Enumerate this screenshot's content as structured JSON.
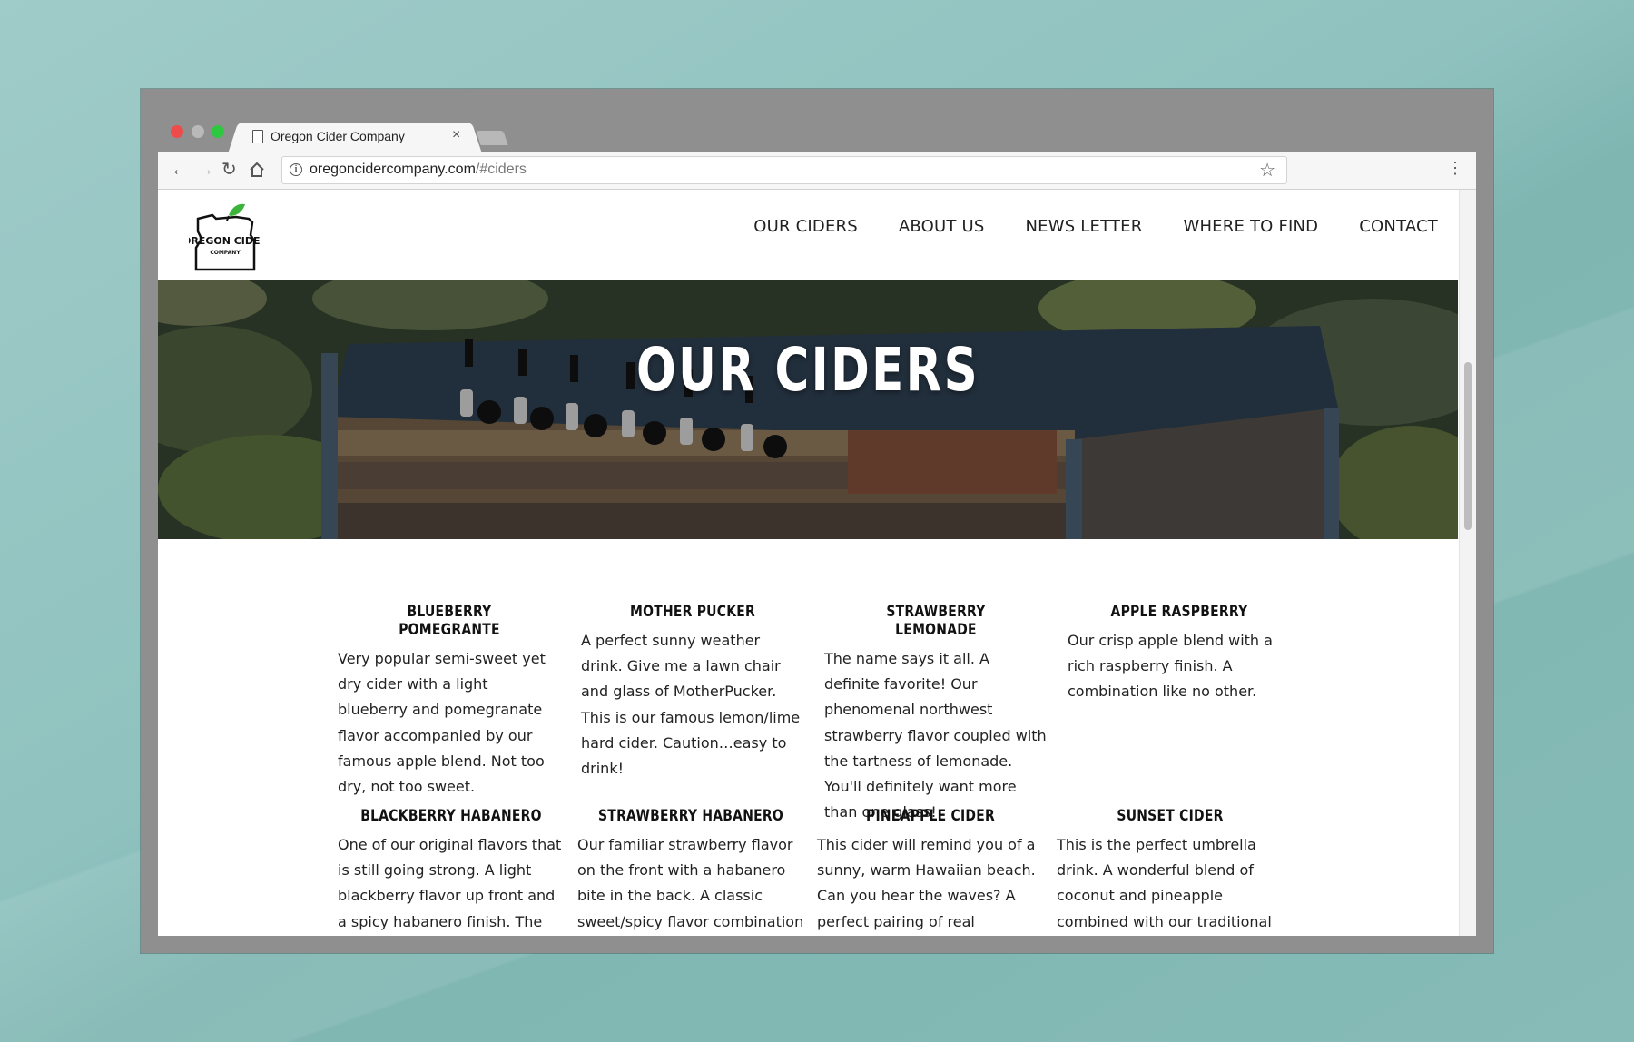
{
  "browser": {
    "tab_title": "Oregon Cider Company",
    "tab_close": "×",
    "url_host": "oregoncidercompany.com",
    "url_path": "/#ciders"
  },
  "site": {
    "logo_line1": "OREGON CIDER",
    "logo_line2": "COMPANY",
    "nav": [
      "OUR CIDERS",
      "ABOUT US",
      "NEWS LETTER",
      "WHERE TO FIND",
      "CONTACT"
    ],
    "hero_title": "OUR CIDERS"
  },
  "ciders": [
    {
      "name": "BLUEBERRY POMEGRANTE",
      "description": "Very popular semi-sweet yet dry cider with a light blueberry and pomegranate flavor accompanied by our famous apple blend. Not too dry, not too sweet."
    },
    {
      "name": "MOTHER PUCKER",
      "description": "A perfect sunny weather drink. Give me a lawn chair and glass of MotherPucker. This is our famous lemon/lime hard cider. Caution…easy to drink!"
    },
    {
      "name": "STRAWBERRY LEMONADE",
      "description": "The name says it all. A definite favorite! Our phenomenal northwest strawberry flavor coupled with the tartness of lemonade. You'll definitely want more than one glass!"
    },
    {
      "name": "APPLE RASPBERRY",
      "description": "Our crisp apple blend with a rich raspberry finish. A combination like no other."
    },
    {
      "name": "BLACKBERRY HABANERO",
      "description": "One of our original flavors that is still going strong. A light blackberry flavor up front and a spicy habanero finish. The"
    },
    {
      "name": "STRAWBERRY HABANERO",
      "description": "Our familiar strawberry flavor on the front with a habanero bite in the back. A classic sweet/spicy flavor combination that will leave"
    },
    {
      "name": "PINEAPPLE CIDER",
      "description": "This cider will remind you of a sunny, warm Hawaiian beach. Can you hear the waves? A perfect pairing of real pineapple"
    },
    {
      "name": "SUNSET CIDER",
      "description": "This is the perfect umbrella drink. A wonderful blend of coconut and pineapple combined with our traditional"
    }
  ]
}
